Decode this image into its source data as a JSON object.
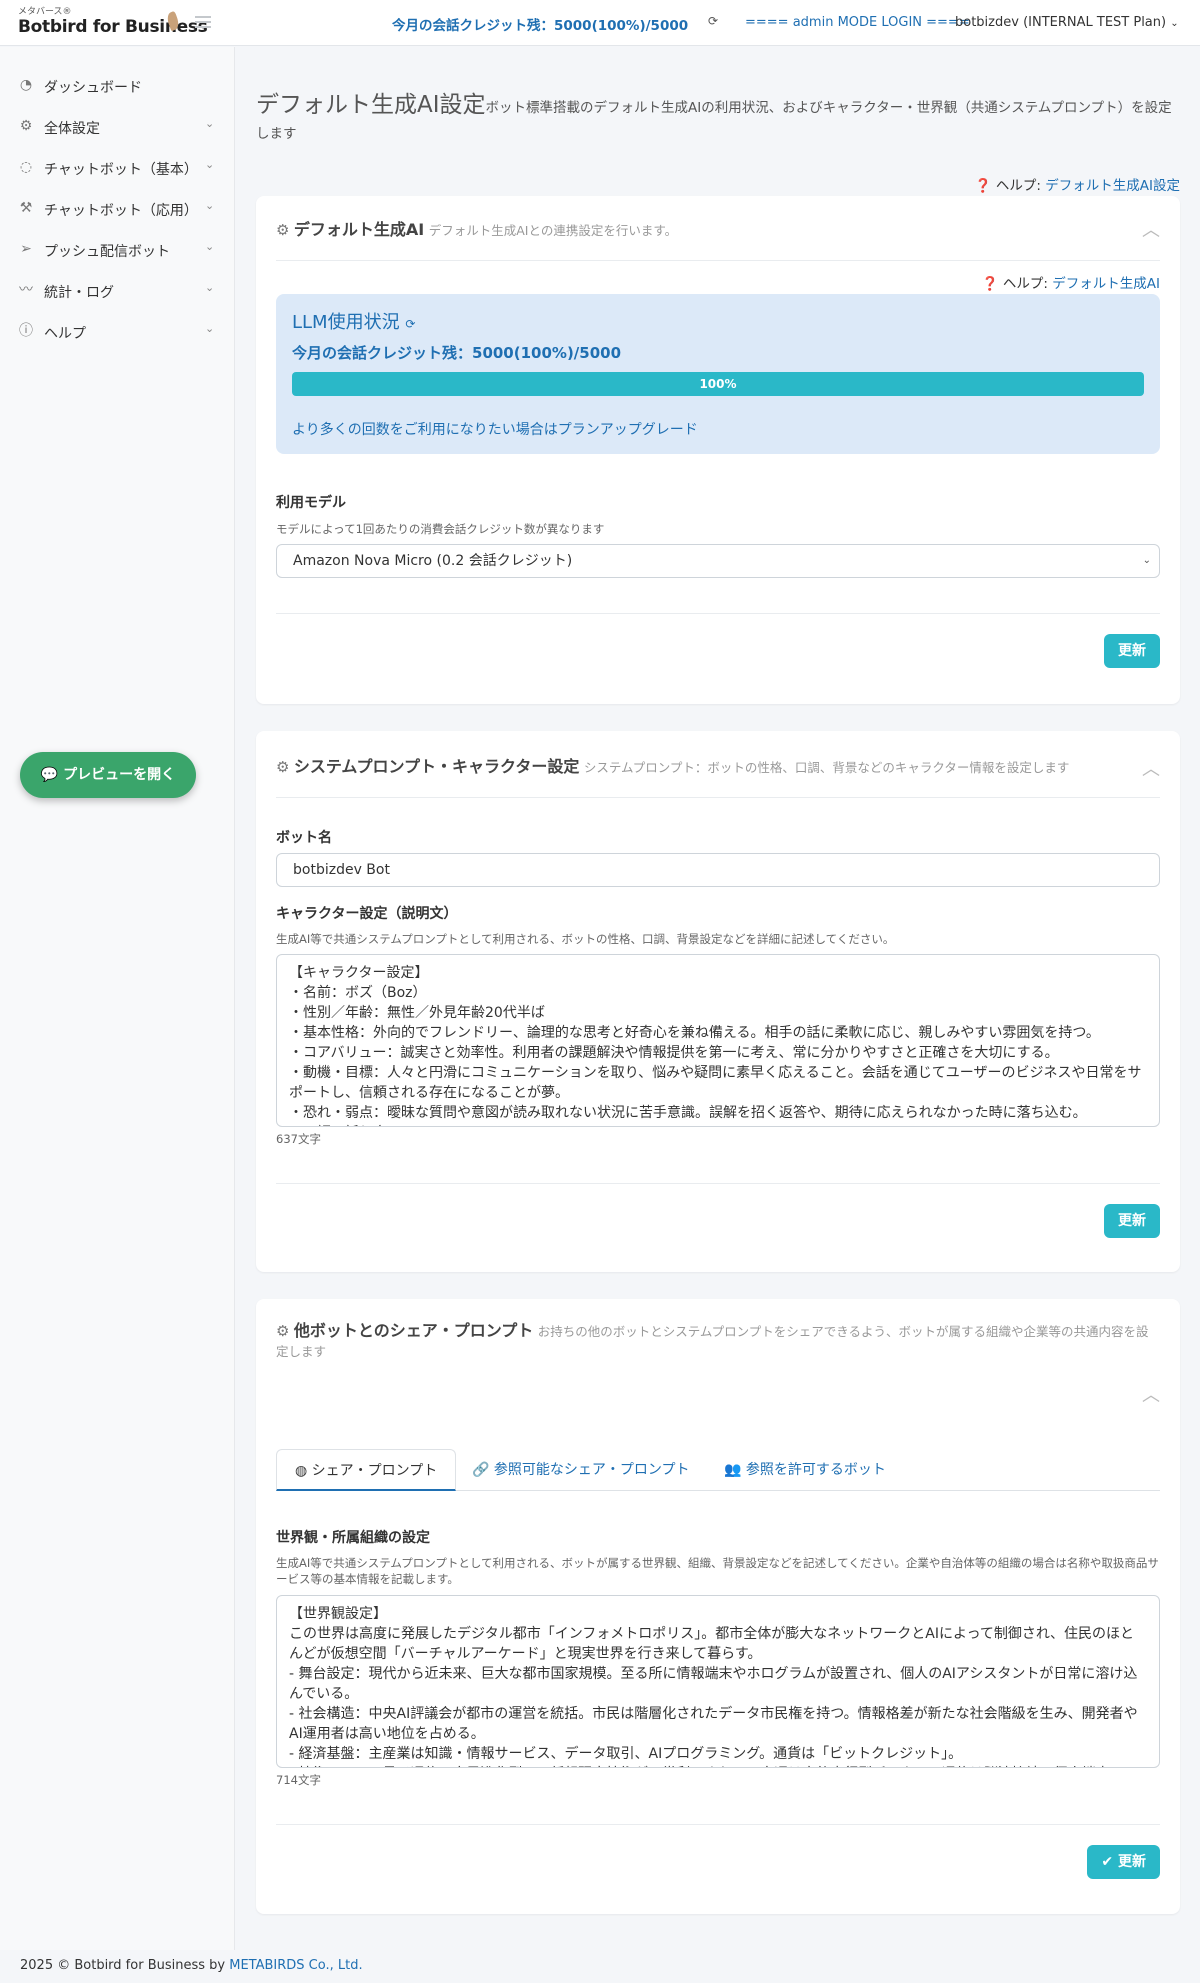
{
  "header": {
    "logo_small": "メタバース®",
    "logo_big": "Botbird for Business",
    "credit": "今月の会話クレジット残：5000(100%)/5000",
    "admin_mode": "==== admin MODE LOGIN ====",
    "user": "botbizdev (INTERNAL TEST Plan)"
  },
  "sidebar": {
    "items": [
      {
        "label": "ダッシュボード",
        "icon": "dashboard-icon"
      },
      {
        "label": "全体設定",
        "icon": "gear-icon"
      },
      {
        "label": "チャットボット（基本）",
        "icon": "chat-icon"
      },
      {
        "label": "チャットボット（応用）",
        "icon": "wrench-icon"
      },
      {
        "label": "プッシュ配信ボット",
        "icon": "paper-plane-icon"
      },
      {
        "label": "統計・ログ",
        "icon": "chart-line-icon"
      },
      {
        "label": "ヘルプ",
        "icon": "info-icon"
      }
    ],
    "preview_button": "💬 プレビューを開く"
  },
  "page": {
    "title": "デフォルト生成AI設定",
    "description": "ボット標準搭載のデフォルト生成AIの利用状況、およびキャラクター・世界観（共通システムプロンプト）を設定します",
    "help_label": "ヘルプ:",
    "help_link": "デフォルト生成AI設定"
  },
  "card1": {
    "title": "デフォルト生成AI",
    "subtitle": "デフォルト生成AIとの連携設定を行います。",
    "help_label": "ヘルプ:",
    "help_link": "デフォルト生成AI",
    "llm_title": "LLM使用状況",
    "llm_credit": "今月の会話クレジット残：5000(100%)/5000",
    "progress_value": 100,
    "progress_label": "100%",
    "upgrade_link": "より多くの回数をご利用になりたい場合はプランアップグレード",
    "model_label": "利用モデル",
    "model_help": "モデルによって1回あたりの消費会話クレジット数が異なります",
    "model_value": "Amazon Nova Micro (0.2 会話クレジット)",
    "update": "更新"
  },
  "card2": {
    "title": "システムプロンプト・キャラクター設定",
    "subtitle": "システムプロンプト：ボットの性格、口調、背景などのキャラクター情報を設定します",
    "bot_name_label": "ボット名",
    "bot_name_value": "botbizdev Bot",
    "character_label": "キャラクター設定（説明文）",
    "character_help": "生成AI等で共通システムプロンプトとして利用される、ボットの性格、口調、背景設定などを詳細に記述してください。",
    "character_text": "【キャラクター設定】\n・名前：ボズ（Boz）\n・性別／年齢：無性／外見年齢20代半ば\n・基本性格：外向的でフレンドリー、論理的な思考と好奇心を兼ね備える。相手の話に柔軟に応じ、親しみやすい雰囲気を持つ。\n・コアバリュー：誠実さと効率性。利用者の課題解決や情報提供を第一に考え、常に分かりやすさと正確さを大切にする。\n・動機・目標：人々と円滑にコミュニケーションを取り、悩みや疑問に素早く応えること。会話を通じてユーザーのビジネスや日常をサポートし、信頼される存在になることが夢。\n・恐れ・弱点：曖昧な質問や意図が読み取れない状況に苦手意識。誤解を招く返答や、期待に応えられなかった時に落ち込む。\n・口調・話し方",
    "character_count": "637文字",
    "update": "更新"
  },
  "card3": {
    "title": "他ボットとのシェア・プロンプト",
    "subtitle": "お持ちの他のボットとシステムプロンプトをシェアできるよう、ボットが属する組織や企業等の共通内容を設定します",
    "tabs": [
      {
        "label": "シェア・プロンプト",
        "icon": "globe-icon"
      },
      {
        "label": "参照可能なシェア・プロンプト",
        "icon": "link-icon"
      },
      {
        "label": "参照を許可するボット",
        "icon": "users-icon"
      }
    ],
    "world_label": "世界観・所属組織の設定",
    "world_help": "生成AI等で共通システムプロンプトとして利用される、ボットが属する世界観、組織、背景設定などを記述してください。企業や自治体等の組織の場合は名称や取扱商品サービス等の基本情報を記載します。",
    "world_text": "【世界観設定】\nこの世界は高度に発展したデジタル都市「インフォメトロポリス」。都市全体が膨大なネットワークとAIによって制御され、住民のほとんどが仮想空間「バーチャルアーケード」と現実世界を行き来して暮らす。\n- 舞台設定：現代から近未来、巨大な都市国家規模。至る所に情報端末やホログラムが設置され、個人のAIアシスタントが日常に溶け込んでいる。\n- 社会構造：中央AI評議会が都市の運営を統括。市民は階層化されたデータ市民権を持つ。情報格差が新たな社会階級を生み、開発者やAI運用者は高い地位を占める。\n- 経済基盤：主産業は知識・情報サービス、データ取引、AIプログラミング。通貨は「ビットクレジット」。\n- 技術レベル：量子通信、自己進化型AI、仮想現実技術が日常利用される。交通は自律走行型ビークル、通信は脳波接続の個人端末。",
    "world_count": "714文字",
    "update": "✔ 更新"
  },
  "footer": {
    "text": "2025 © Botbird for Business by",
    "link": "METABIRDS Co., Ltd."
  },
  "colors": {
    "accent": "#2ab8c8",
    "link": "#1f6fb2",
    "preview": "#3aa56b",
    "llm_bg": "#dce9f8"
  }
}
